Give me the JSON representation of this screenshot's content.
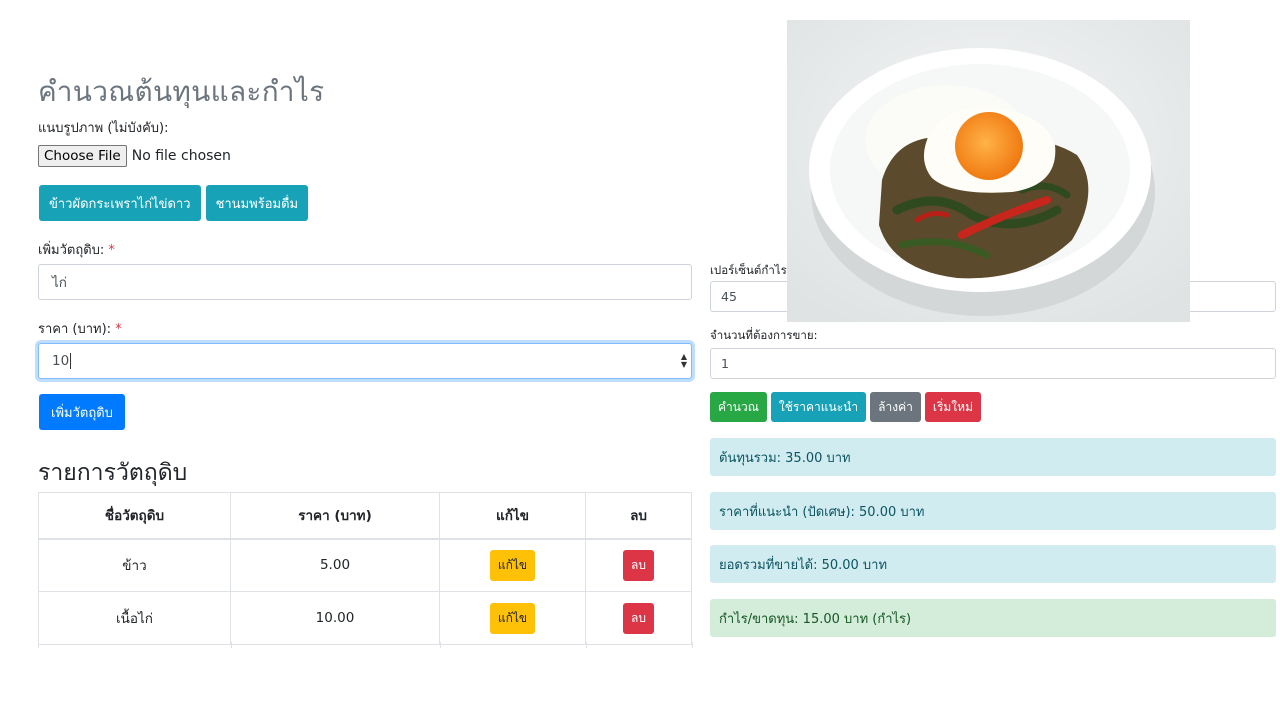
{
  "header": {
    "title": "คำนวณต้นทุนและกำไร"
  },
  "attach": {
    "label": "แนบรูปภาพ (ไม่บังคับ):",
    "button": "Choose File",
    "status": "No file chosen"
  },
  "presets": [
    "ข้าวผัดกระเพราไก่ไข่ดาว",
    "ชานมพร้อมดื่ม"
  ],
  "ingredient_form": {
    "name_label": "เพิ่มวัตถุดิบ:",
    "name_value": "ไก่",
    "price_label": "ราคา (บาท):",
    "price_value": "10",
    "required_mark": "*",
    "add_button": "เพิ่มวัตถุดิบ"
  },
  "ingredient_list": {
    "title": "รายการวัตถุดิบ",
    "columns": [
      "ชื่อวัตถุดิบ",
      "ราคา (บาท)",
      "แก้ไข",
      "ลบ"
    ],
    "rows": [
      {
        "name": "ข้าว",
        "price": "5.00",
        "edit": "แก้ไข",
        "delete": "ลบ"
      },
      {
        "name": "เนื้อไก่",
        "price": "10.00",
        "edit": "แก้ไข",
        "delete": "ลบ"
      }
    ]
  },
  "calc_form": {
    "percent_label": "เปอร์เซ็นต์กำไร",
    "percent_value": "45",
    "qty_label": "จำนวนที่ต้องการขาย:",
    "qty_value": "1"
  },
  "actions": {
    "calculate": "คำนวณ",
    "use_suggested": "ใช้ราคาแนะนำ",
    "clear": "ล้างค่า",
    "restart": "เริ่มใหม่"
  },
  "results": {
    "total_cost": "ต้นทุนรวม: 35.00 บาท",
    "suggested_price": "ราคาที่แนะนำ (ปัดเศษ): 50.00 บาท",
    "total_sales": "ยอดรวมที่ขายได้: 50.00 บาท",
    "profit": "กำไร/ขาดทุน: 15.00 บาท (กำไร)"
  },
  "colors": {
    "primary": "#007bff",
    "info": "#17a2b8",
    "success": "#28a745",
    "secondary": "#6c757d",
    "danger": "#dc3545",
    "warning": "#ffc107",
    "info_alert": "#d1ecf1",
    "success_alert": "#d4edda"
  }
}
